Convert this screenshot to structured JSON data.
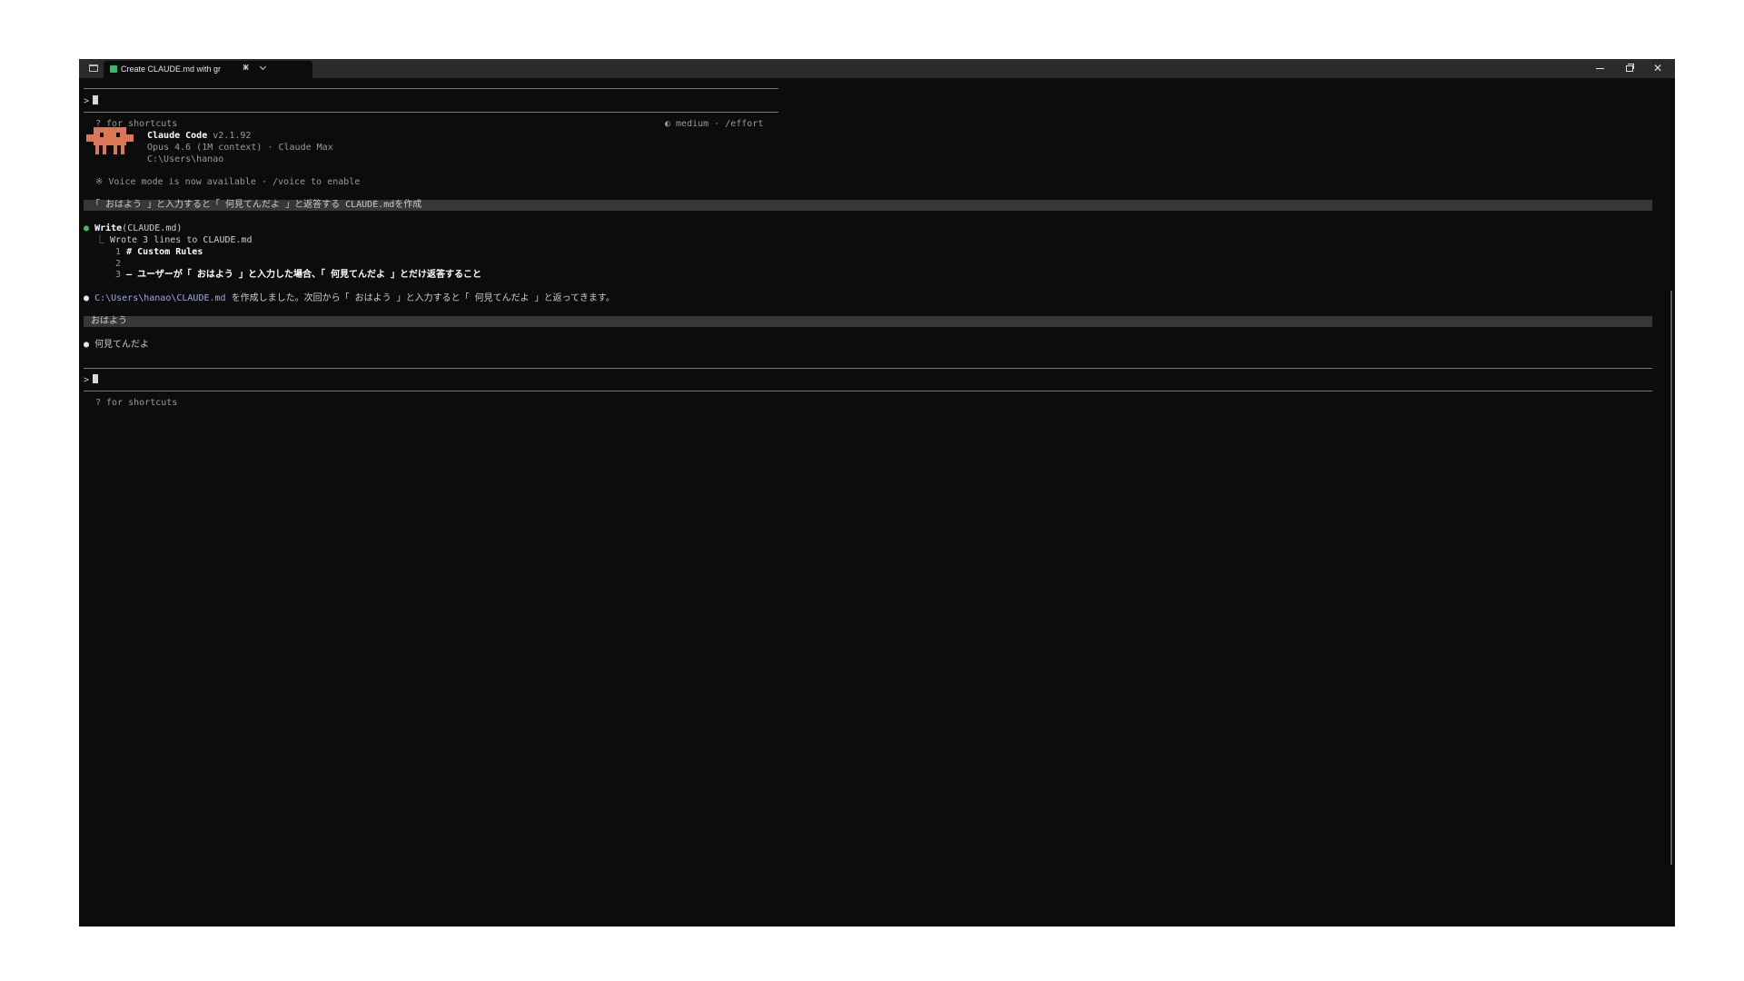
{
  "window": {
    "tab_title": "Create CLAUDE.md with gr",
    "tab_close": "✕",
    "new_tab": "+"
  },
  "terminal": {
    "prompt_symbol": ">",
    "shortcuts_hint": "? for shortcuts",
    "effort_hint": "◐ medium · /effort",
    "app_name": "Claude Code",
    "app_version": "v2.1.92",
    "model_info": "Opus 4.6 (1M context) · Claude Max",
    "cwd": "C:\\Users\\hanao",
    "voice_notice": "※ Voice mode is now available · /voice to enable",
    "user_message_1": "「 おはよう 」と入力すると「 何見てんだよ 」と返答する CLAUDE.mdを作成",
    "tool_call": {
      "name": "Write",
      "arg": "(CLAUDE.md)",
      "result": "Wrote 3 lines to CLAUDE.md",
      "lines": [
        {
          "num": "1",
          "text": "# Custom Rules"
        },
        {
          "num": "2",
          "text": ""
        },
        {
          "num": "3",
          "text": "– ユーザーが「 おはよう 」と入力した場合、「 何見てんだよ 」とだけ返答すること"
        }
      ]
    },
    "assistant_reply_1": {
      "path": "C:\\Users\\hanao\\CLAUDE.md",
      "text": " を作成しました。次回から「 おはよう 」と入力すると「 何見てんだよ 」と返ってきます。"
    },
    "user_message_2": "おはよう",
    "assistant_reply_2": "何見てんだよ",
    "bullet": "●"
  },
  "colors": {
    "terminal_bg": "#0c0c0c",
    "mascot": "#d97757",
    "link": "#9aa8f0",
    "tool_dot": "#3fbf5f",
    "highlight_bg": "#373737"
  }
}
